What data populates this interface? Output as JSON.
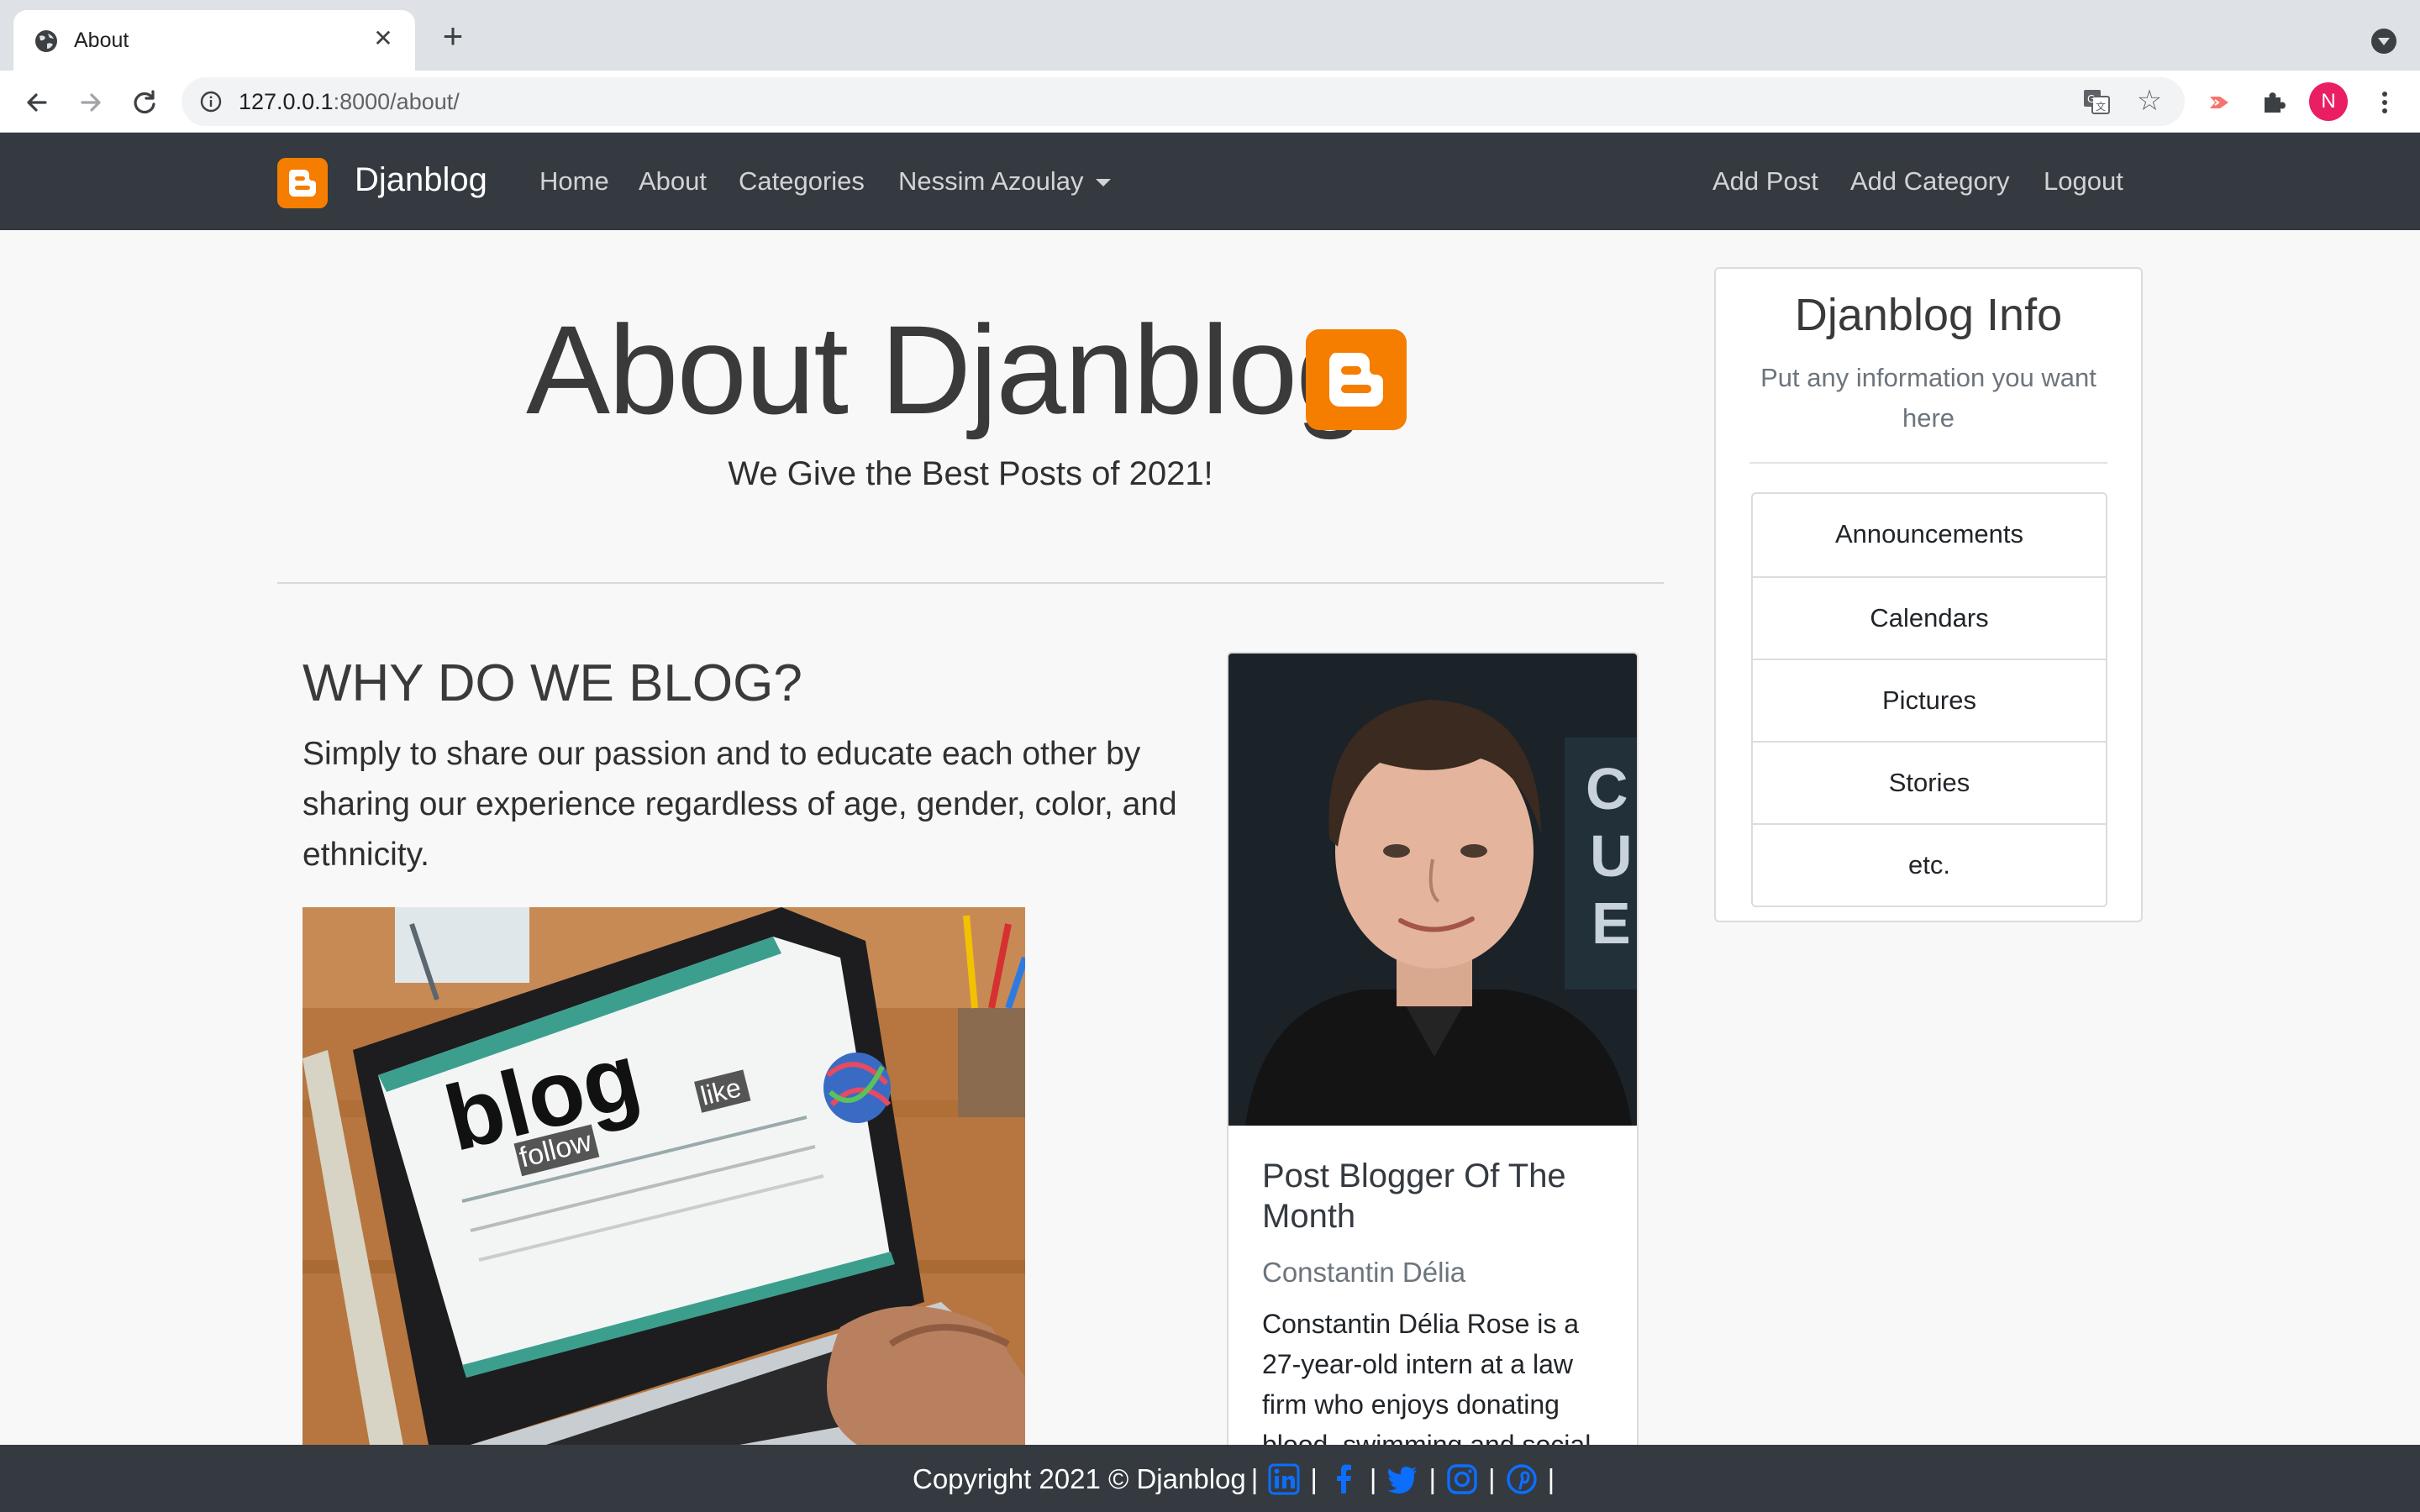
{
  "browser": {
    "tab_title": "About",
    "url_host": "127.0.0.1",
    "url_rest": ":8000/about/",
    "avatar_letter": "N"
  },
  "navbar": {
    "brand": "Djanblog",
    "links": [
      "Home",
      "About",
      "Categories",
      "Nessim Azoulay"
    ],
    "right_links": [
      "Add Post",
      "Add Category",
      "Logout"
    ]
  },
  "hero": {
    "title": "About Djanblog",
    "subtitle": "We Give the Best Posts of 2021!"
  },
  "why": {
    "title": "WHY DO WE BLOG?",
    "text": "Simply to share our passion and to educate each other by sharing our experience regardless of age, gender, color, and ethnicity.",
    "image_words": {
      "main": "blog",
      "follow": "follow",
      "like": "like"
    }
  },
  "card": {
    "title": "Post Blogger Of The Month",
    "subtitle": "Constantin Délia",
    "text": "Constantin Délia Rose is a 27-year-old intern at a law firm who enjoys donating blood, swimming and social"
  },
  "sidebar": {
    "title": "Djanblog Info",
    "subtitle": "Put any information you want here",
    "categories": [
      "Announcements",
      "Calendars",
      "Pictures",
      "Stories",
      "etc."
    ]
  },
  "footer": {
    "copyright": "Copyright 2021 © Djanblog",
    "separator": "|",
    "social": [
      "linkedin-icon",
      "facebook-icon",
      "twitter-icon",
      "instagram-icon",
      "pinterest-icon"
    ]
  },
  "colors": {
    "navbar": "#343a40",
    "brand_orange": "#f57d00",
    "social_blue": "#0d6efd"
  }
}
